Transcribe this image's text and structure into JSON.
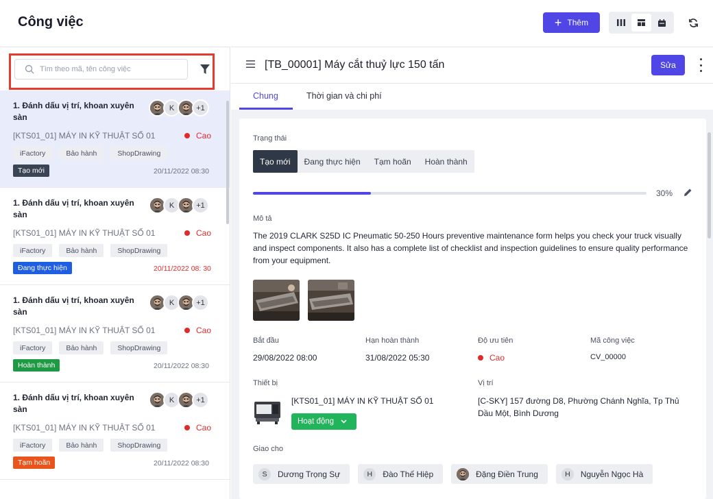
{
  "header": {
    "title": "Công việc",
    "add_label": "Thêm",
    "view_icons": [
      "columns-icon",
      "board-icon",
      "calendar-icon"
    ],
    "refresh_icon": "refresh-icon"
  },
  "search": {
    "placeholder": "Tìm theo mã, tên công việc",
    "filter_icon": "filter-icon"
  },
  "tasks": [
    {
      "title": "1. Đánh dấu vị trí, khoan xuyên sàn",
      "avatars": [
        "photo",
        "K",
        "photo"
      ],
      "more": "+1",
      "device": "[KTS01_01] MÁY IN KỸ THUẬT SỐ 01",
      "priority": "Cao",
      "tags": [
        "iFactory",
        "Bảo hành",
        "ShopDrawing"
      ],
      "status": "Tạo mới",
      "status_color": "#3b4455",
      "date": "20/11/2022 08:30",
      "overdue": false
    },
    {
      "title": "1. Đánh dấu vị trí, khoan xuyên sàn",
      "avatars": [
        "photo",
        "K",
        "photo"
      ],
      "more": "+1",
      "device": "[KTS01_01] MÁY IN KỸ THUẬT SỐ 01",
      "priority": "Cao",
      "tags": [
        "iFactory",
        "Bảo hành",
        "ShopDrawing"
      ],
      "status": "Đang thực hiện",
      "status_color": "#1f5ee0",
      "date": "20/11/2022 08: 30",
      "overdue": true
    },
    {
      "title": "1. Đánh dấu vị trí, khoan xuyên sàn",
      "avatars": [
        "photo",
        "K",
        "photo"
      ],
      "more": "+1",
      "device": "[KTS01_01] MÁY IN KỸ THUẬT SỐ 01",
      "priority": "Cao",
      "tags": [
        "iFactory",
        "Bảo hành",
        "ShopDrawing"
      ],
      "status": "Hoàn thành",
      "status_color": "#1f9a44",
      "date": "20/11/2022 08:30",
      "overdue": false
    },
    {
      "title": "1. Đánh dấu vị trí, khoan xuyên sàn",
      "avatars": [
        "photo",
        "K",
        "photo"
      ],
      "more": "+1",
      "device": "[KTS01_01] MÁY IN KỸ THUẬT SỐ 01",
      "priority": "Cao",
      "tags": [
        "iFactory",
        "Bảo hành",
        "ShopDrawing"
      ],
      "status": "Tạm hoãn",
      "status_color": "#e8541b",
      "date": "20/11/2022 08:30",
      "overdue": false
    }
  ],
  "detail": {
    "title": "[TB_00001] Máy cắt thuỷ lực 150 tấn",
    "edit_label": "Sửa",
    "tabs": [
      "Chung",
      "Thời gian và chi phí"
    ],
    "status_label": "Trạng thái",
    "status_options": [
      "Tạo mới",
      "Đang thực hiện",
      "Tạm hoãn",
      "Hoàn thành"
    ],
    "progress": 0.3,
    "progress_text": "30%",
    "description_label": "Mô tả",
    "description": "The 2019 CLARK S25D IC Pneumatic 50-250 Hours preventive maintenance form helps you check your truck visually and inspect components. It also has a complete list of checklist and inspection guidelines to ensure quality performance from your equipment.",
    "start_label": "Bắt đầu",
    "start_value": "29/08/2022 08:00",
    "deadline_label": "Hạn hoàn thành",
    "deadline_value": "31/08/2022 05:30",
    "priority_label": "Độ ưu tiên",
    "priority_value": "Cao",
    "code_label": "Mã công việc",
    "code_value": "CV_00000",
    "equipment_label": "Thiết bị",
    "equipment_name": "[KTS01_01] MÁY IN KỸ THUẬT SỐ 01",
    "equipment_status": "Hoạt động",
    "location_label": "Vị trí",
    "location_value": "[C-SKY] 157 đường D8, Phường Chánh Nghĩa, Tp Thủ Dầu Một, Bình Dương",
    "assign_label": "Giao cho",
    "assignees": [
      {
        "initial": "S",
        "name": "Dương Trọng Sự",
        "photo": false
      },
      {
        "initial": "H",
        "name": "Đào Thế Hiệp",
        "photo": false
      },
      {
        "initial": "",
        "name": "Đặng Điền Trung",
        "photo": true
      },
      {
        "initial": "H",
        "name": "Nguyễn Ngọc Hà",
        "photo": false
      }
    ]
  },
  "colors": {
    "primary": "#4f46e5",
    "danger": "#e02b2b",
    "success": "#22b45a",
    "highlight_border": "#e53b2c"
  }
}
